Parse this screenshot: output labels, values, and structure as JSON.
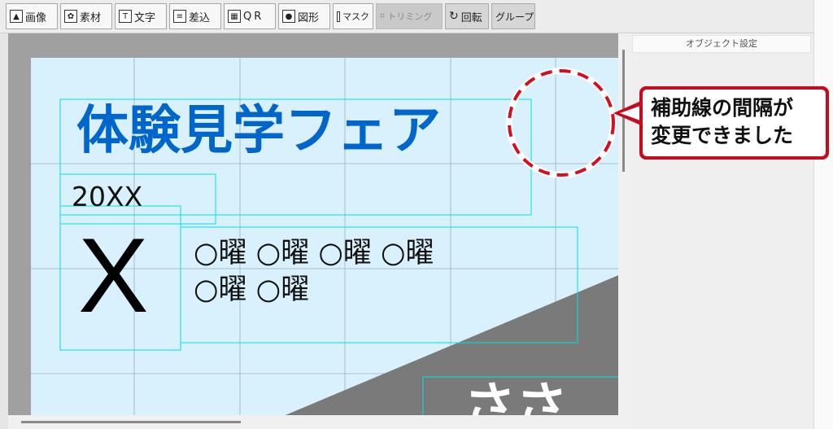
{
  "toolbar": {
    "buttons": [
      {
        "label": "画像",
        "icon": "image-icon"
      },
      {
        "label": "素材",
        "icon": "material-icon"
      },
      {
        "label": "文字",
        "icon": "text-icon"
      },
      {
        "label": "差込",
        "icon": "insert-icon"
      },
      {
        "label": "QR",
        "icon": "qr-icon"
      },
      {
        "label": "図形",
        "icon": "shape-icon"
      },
      {
        "label": "マスク",
        "icon": "mask-icon"
      },
      {
        "label": "トリミング",
        "icon": "crop-icon"
      },
      {
        "label": "回転",
        "icon": "rotate-icon"
      },
      {
        "label": "グループ",
        "icon": ""
      }
    ]
  },
  "panel": {
    "title": "オブジェクト設定"
  },
  "canvas": {
    "title": "体験見学フェア",
    "year": "20XX",
    "big_letter": "X",
    "days_line1": "○曜 ○曜 ○曜 ○曜",
    "days_line2": "○曜 ○曜",
    "bottom_text": "ささ"
  },
  "callout": {
    "text": "補助線の間隔が\n変更できました"
  },
  "colors": {
    "title": "#0066cc",
    "canvas_bg": "#d9f1fc",
    "guide": "#00e0ee",
    "callout_border": "#c80a1e"
  }
}
